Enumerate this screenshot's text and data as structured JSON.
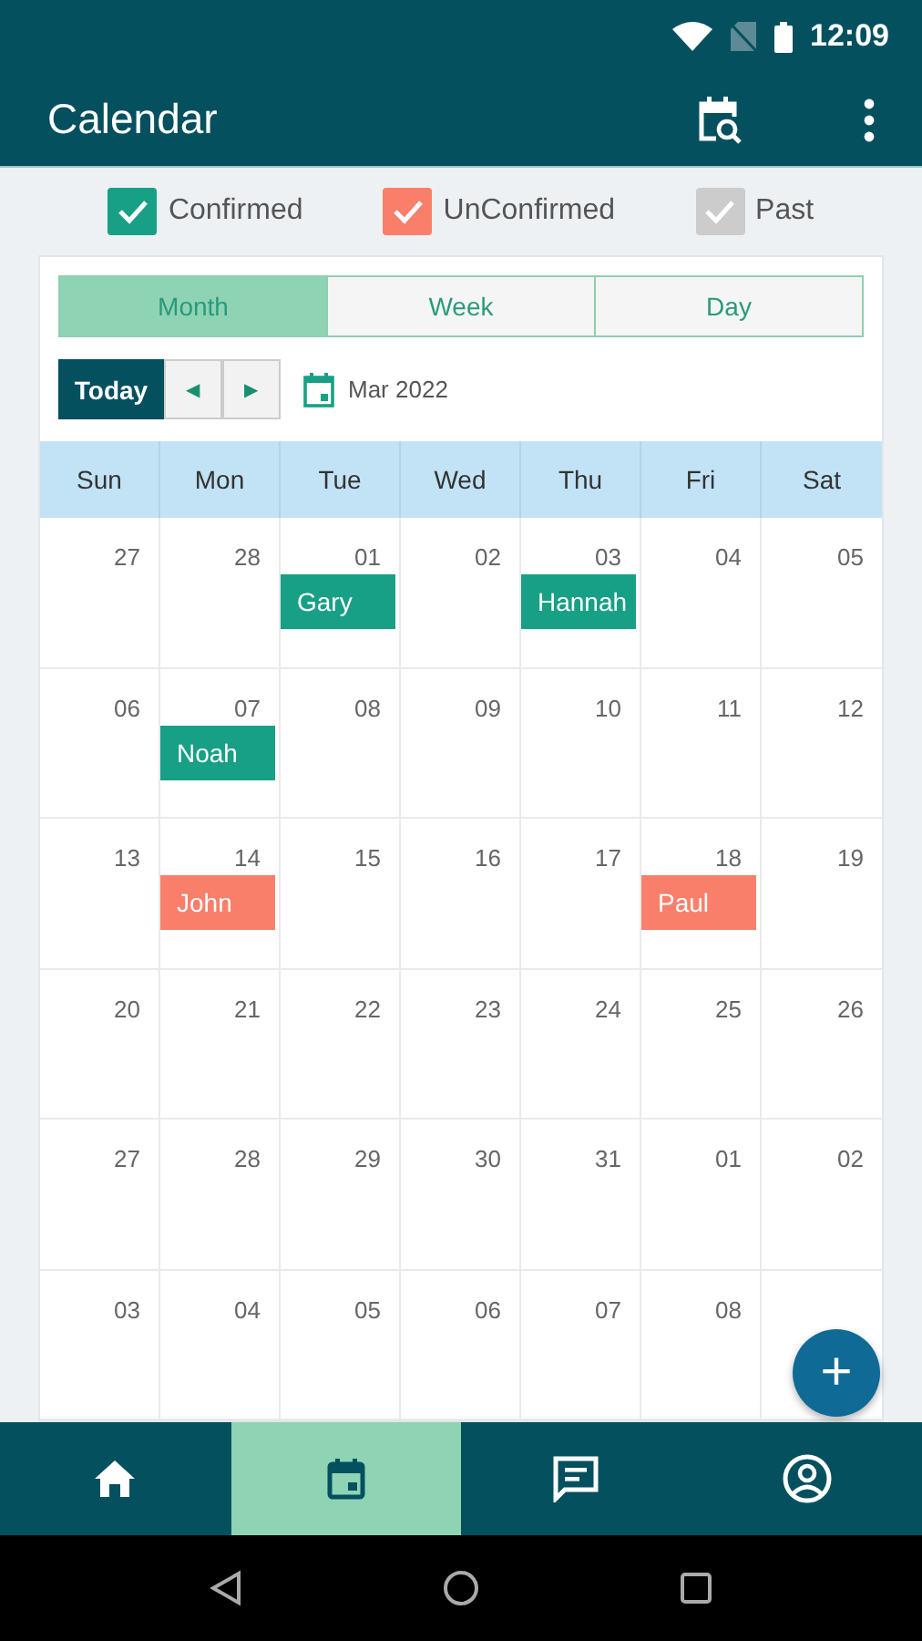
{
  "status_bar": {
    "time": "12:09"
  },
  "app_bar": {
    "title": "Calendar"
  },
  "legend": [
    {
      "label": "Confirmed",
      "checked": true,
      "color": "#17a085"
    },
    {
      "label": "UnConfirmed",
      "checked": true,
      "color": "#fa7f6b"
    },
    {
      "label": "Past",
      "checked": true,
      "color": "#cccccc"
    }
  ],
  "view_tabs": [
    {
      "label": "Month",
      "selected": true
    },
    {
      "label": "Week",
      "selected": false
    },
    {
      "label": "Day",
      "selected": false
    }
  ],
  "toolbar": {
    "today": "Today",
    "prev": "◀",
    "next": "▶",
    "month": "Mar 2022"
  },
  "weekdays": [
    "Sun",
    "Mon",
    "Tue",
    "Wed",
    "Thu",
    "Fri",
    "Sat"
  ],
  "weeks": [
    {
      "days": [
        {
          "day": "27"
        },
        {
          "day": "28"
        },
        {
          "day": "01",
          "events": [
            {
              "name": "Gary",
              "color": "#17a085"
            }
          ]
        },
        {
          "day": "02"
        },
        {
          "day": "03",
          "events": [
            {
              "name": "Hannah",
              "color": "#17a085"
            }
          ]
        },
        {
          "day": "04"
        },
        {
          "day": "05"
        }
      ]
    },
    {
      "days": [
        {
          "day": "06"
        },
        {
          "day": "07",
          "events": [
            {
              "name": "Noah",
              "color": "#17a085"
            }
          ]
        },
        {
          "day": "08"
        },
        {
          "day": "09"
        },
        {
          "day": "10"
        },
        {
          "day": "11"
        },
        {
          "day": "12"
        }
      ]
    },
    {
      "days": [
        {
          "day": "13"
        },
        {
          "day": "14",
          "events": [
            {
              "name": "John",
              "color": "#fa7f6b"
            }
          ]
        },
        {
          "day": "15"
        },
        {
          "day": "16"
        },
        {
          "day": "17"
        },
        {
          "day": "18",
          "events": [
            {
              "name": "Paul",
              "color": "#fa7f6b"
            }
          ]
        },
        {
          "day": "19"
        }
      ]
    },
    {
      "days": [
        {
          "day": "20"
        },
        {
          "day": "21"
        },
        {
          "day": "22"
        },
        {
          "day": "23"
        },
        {
          "day": "24"
        },
        {
          "day": "25"
        },
        {
          "day": "26"
        }
      ]
    },
    {
      "days": [
        {
          "day": "27"
        },
        {
          "day": "28"
        },
        {
          "day": "29"
        },
        {
          "day": "30"
        },
        {
          "day": "31"
        },
        {
          "day": "01"
        },
        {
          "day": "02"
        }
      ]
    },
    {
      "days": [
        {
          "day": "03"
        },
        {
          "day": "04"
        },
        {
          "day": "05"
        },
        {
          "day": "06"
        },
        {
          "day": "07"
        },
        {
          "day": "08"
        }
      ]
    }
  ],
  "fab": {
    "label": "+"
  },
  "bottom_nav": [
    {
      "kind": "home",
      "selected": false
    },
    {
      "kind": "calendar",
      "selected": true
    },
    {
      "kind": "chat",
      "selected": false
    },
    {
      "kind": "profile",
      "selected": false
    }
  ]
}
